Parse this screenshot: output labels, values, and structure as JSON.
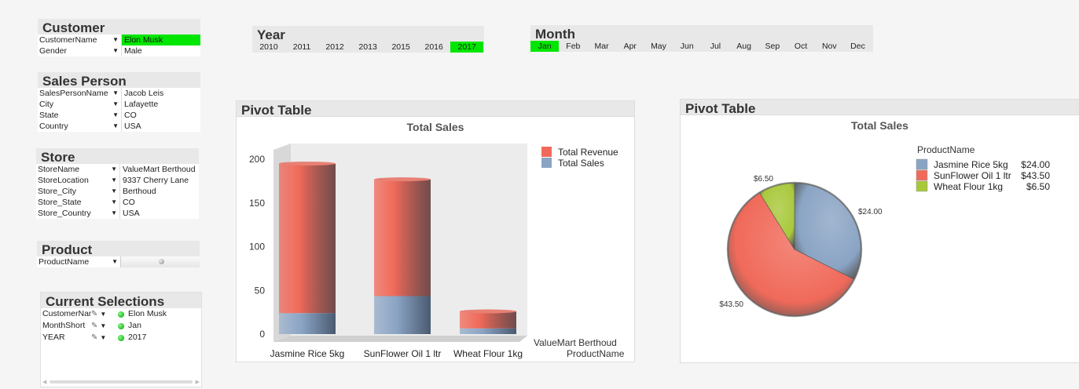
{
  "customer": {
    "title": "Customer",
    "fields": [
      {
        "name": "CustomerName",
        "value": "Elon Musk",
        "selected": true
      },
      {
        "name": "Gender",
        "value": "Male",
        "selected": false
      }
    ]
  },
  "sales_person": {
    "title": "Sales Person",
    "fields": [
      {
        "name": "SalesPersonName",
        "value": "Jacob Leis"
      },
      {
        "name": "City",
        "value": "Lafayette"
      },
      {
        "name": "State",
        "value": "CO"
      },
      {
        "name": "Country",
        "value": "USA"
      }
    ]
  },
  "store": {
    "title": "Store",
    "fields": [
      {
        "name": "StoreName",
        "value": "ValueMart Berthoud"
      },
      {
        "name": "StoreLocation",
        "value": "9337 Cherry Lane"
      },
      {
        "name": "Store_City",
        "value": "Berthoud"
      },
      {
        "name": "Store_State",
        "value": "CO"
      },
      {
        "name": "Store_Country",
        "value": "USA"
      }
    ]
  },
  "product": {
    "title": "Product",
    "fields": [
      {
        "name": "ProductName",
        "value": ""
      }
    ]
  },
  "current_selections": {
    "title": "Current Selections",
    "rows": [
      {
        "field": "CustomerName",
        "value": "Elon Musk"
      },
      {
        "field": "MonthShort",
        "value": "Jan"
      },
      {
        "field": "YEAR",
        "value": "2017"
      }
    ]
  },
  "year": {
    "title": "Year",
    "items": [
      "2010",
      "2011",
      "2012",
      "2013",
      "2015",
      "2016",
      "2017"
    ],
    "selected": "2017"
  },
  "month": {
    "title": "Month",
    "items": [
      "Jan",
      "Feb",
      "Mar",
      "Apr",
      "May",
      "Jun",
      "Jul",
      "Aug",
      "Sep",
      "Oct",
      "Nov",
      "Dec"
    ],
    "selected": "Jan"
  },
  "pivot1": {
    "title": "Pivot Table",
    "side_label": "ValueMart Berthoud",
    "xlabel": "ProductName"
  },
  "pivot2": {
    "title": "Pivot Table",
    "legend_title": "ProductName"
  },
  "colors": {
    "revenue": "#f06a5a",
    "sales": "#8aa4c4",
    "pie_jasmine": "#8aa4c4",
    "pie_sunflower": "#f06a5a",
    "pie_wheat": "#a8c83a",
    "selected": "#00e600"
  },
  "chart_data": [
    {
      "type": "bar",
      "title": "Total Sales",
      "stacked": true,
      "categories": [
        "Jasmine Rice 5kg",
        "SunFlower Oil 1 ltr",
        "Wheat Flour 1kg"
      ],
      "series": [
        {
          "name": "Total Sales",
          "values": [
            24,
            43.5,
            6.5
          ]
        },
        {
          "name": "Total Revenue",
          "values": [
            171,
            133.5,
            19.5
          ]
        }
      ],
      "ylim": [
        0,
        200
      ],
      "yticks": [
        0,
        50,
        100,
        150,
        200
      ],
      "xlabel": "ProductName",
      "legend": "top-right"
    },
    {
      "type": "pie",
      "title": "Total Sales",
      "legend_title": "ProductName",
      "labels": [
        "Jasmine Rice 5kg",
        "SunFlower Oil 1 ltr",
        "Wheat Flour 1kg"
      ],
      "values": [
        24.0,
        43.5,
        6.5
      ],
      "value_labels": [
        "$24.00",
        "$43.50",
        "$6.50"
      ],
      "legend": "top-right"
    }
  ]
}
